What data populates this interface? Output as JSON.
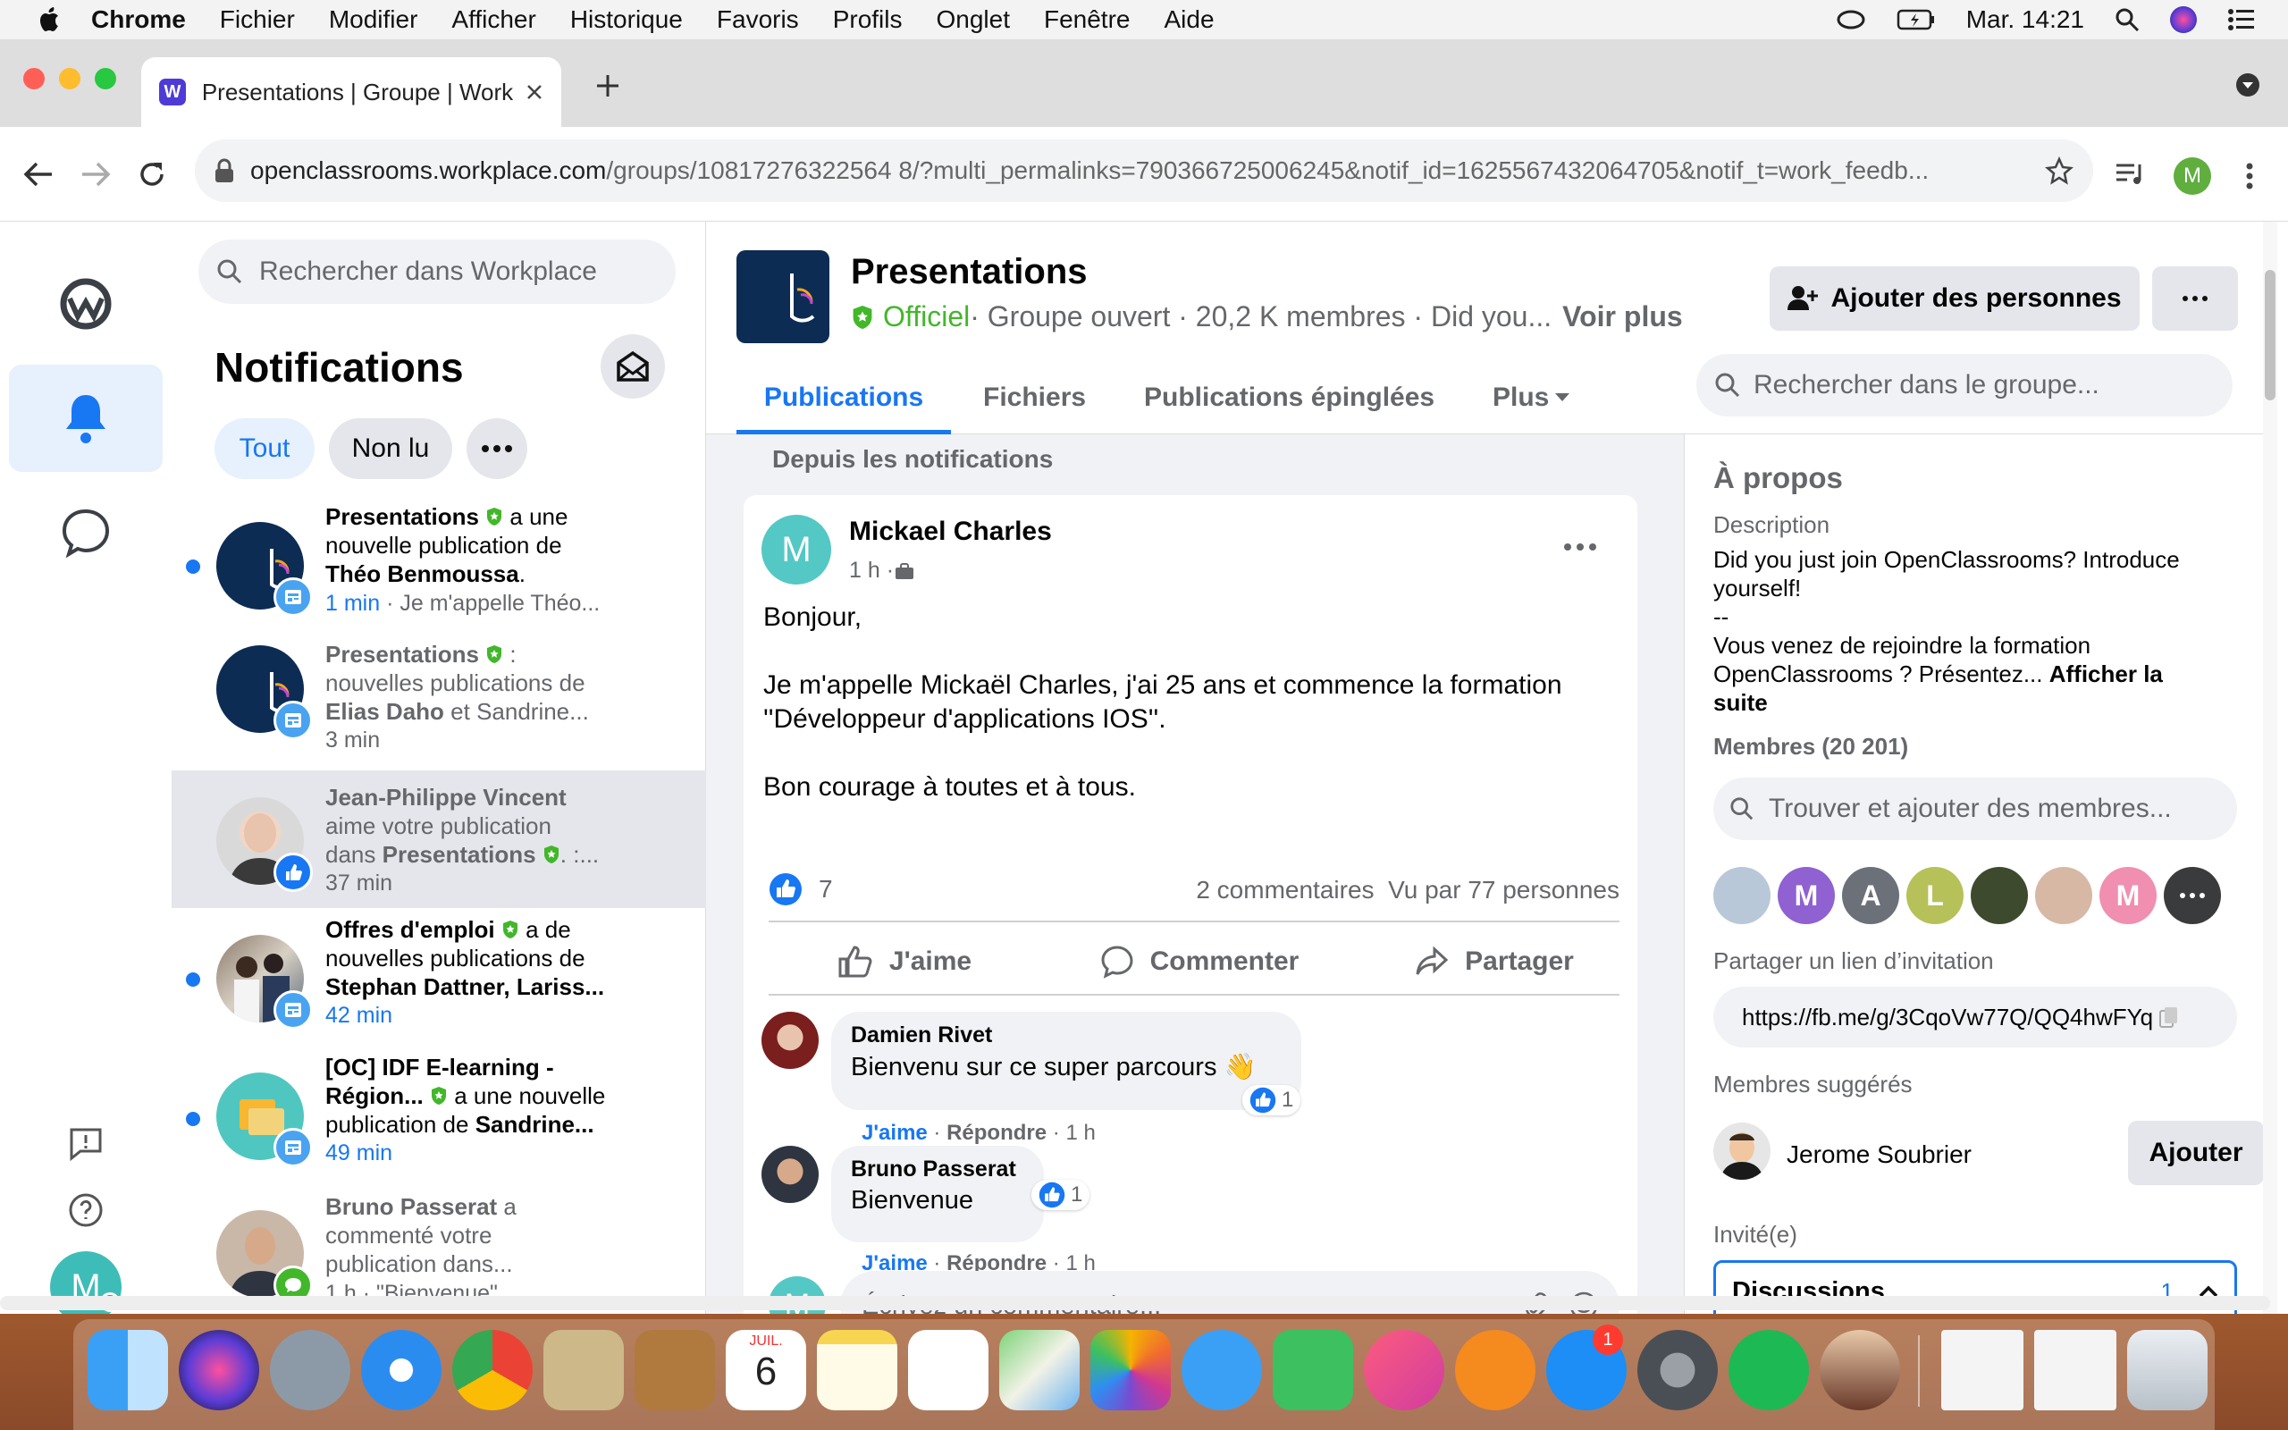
{
  "menubar": {
    "app": "Chrome",
    "items": [
      "Fichier",
      "Modifier",
      "Afficher",
      "Historique",
      "Favoris",
      "Profils",
      "Onglet",
      "Fenêtre",
      "Aide"
    ],
    "clock": "Mar. 14:21"
  },
  "browser": {
    "tab_title": "Presentations | Groupe | Workp",
    "url_host": "openclassrooms.workplace.com",
    "url_path": "/groups/10817276322564 8/?multi_permalinks=790366725006245&notif_id=1625567432064705&notif_t=work_feedb...",
    "profile_initial": "M"
  },
  "notifications": {
    "search_placeholder": "Rechercher dans Workplace",
    "title": "Notifications",
    "filter_all": "Tout",
    "filter_unread": "Non lu",
    "items": [
      {
        "line1_bold": "Presentations",
        "line1_rest": " a une",
        "line2": "nouvelle publication de",
        "line3_bold": "Théo Benmoussa",
        "line3_rest": ".",
        "time": "1 min",
        "preview": " · Je m'appelle Théo..."
      },
      {
        "line1_bold": "Presentations",
        "line1_rest": " :",
        "line2": "nouvelles publications de",
        "line3_bold": "Elias Daho",
        "line3_rest": " et Sandrine...",
        "time": "3 min",
        "preview": ""
      },
      {
        "line1_bold": "Jean-Philippe Vincent",
        "line1_rest": "",
        "line2": "aime votre publication",
        "line3_bold": "Presentations",
        "line3_pre": "dans ",
        "line3_rest": ". :...",
        "time": "37 min",
        "preview": ""
      },
      {
        "line1_bold": "Offres d'emploi",
        "line1_rest": " a de",
        "line2": "nouvelles publications de",
        "line3_bold": "Stephan Dattner, Lariss...",
        "line3_rest": "",
        "time": "42 min",
        "preview": ""
      },
      {
        "line1_bold": "[OC] IDF E-learning -",
        "line1_rest": "",
        "line2_bold": "Région...",
        "line2": " a une nouvelle",
        "line3_pre": "publication de ",
        "line3_bold": "Sandrine...",
        "line3_rest": "",
        "time": "49 min",
        "preview": ""
      },
      {
        "line1_bold": "Bruno Passerat",
        "line1_rest": " a",
        "line2": "commenté votre",
        "line3_pre": "publication dans...",
        "line3_bold": "",
        "line3_rest": "",
        "time": "1 h",
        "preview": " · \"Bienvenue\""
      }
    ]
  },
  "group": {
    "name": "Presentations",
    "official": "Officiel",
    "meta": " · Groupe ouvert · 20,2 K membres · Did you...",
    "see_more": "Voir plus",
    "add_people": "Ajouter des personnes",
    "tabs": [
      "Publications",
      "Fichiers",
      "Publications épinglées",
      "Plus"
    ],
    "search_placeholder": "Rechercher dans le groupe..."
  },
  "feed": {
    "section_label": "Depuis les notifications",
    "post": {
      "author": "Mickael Charles",
      "author_initial": "M",
      "time": "1 h · ",
      "line1": "Bonjour,",
      "line2": "Je m'appelle Mickaël Charles, j'ai 25 ans et commence la formation",
      "line3": "''Développeur d'applications IOS''.",
      "line4": "Bon courage à toutes et à tous.",
      "likes": "7",
      "comments_count": "2 commentaires",
      "seen_by": "Vu par 77 personnes",
      "like": "J'aime",
      "comment": "Commenter",
      "share": "Partager"
    },
    "comments": [
      {
        "name": "Damien Rivet",
        "text": "Bienvenu sur ce super parcours 👋",
        "reactions": "1",
        "like": "J'aime",
        "reply": "Répondre",
        "time": "1 h"
      },
      {
        "name": "Bruno Passerat",
        "text": "Bienvenue",
        "reactions": "1",
        "like": "J'aime",
        "reply": "Répondre",
        "time": "1 h"
      }
    ],
    "comment_placeholder": "Écrivez un commentaire...",
    "composer_initial": "M"
  },
  "about": {
    "title": "À propos",
    "desc_label": "Description",
    "desc_1": "Did you just join OpenClassrooms? Introduce",
    "desc_2": "yourself!",
    "desc_3": "--",
    "desc_4": "Vous venez de rejoindre la formation",
    "desc_5": "OpenClassrooms ? Présentez...",
    "show_more": "Afficher la",
    "show_more_2": "suite",
    "members_label": "Membres (20 201)",
    "members_search": "Trouver et ajouter des membres...",
    "member_initials": [
      "M",
      "A",
      "L",
      "M"
    ],
    "invite_label": "Partager un lien d’invitation",
    "invite_link": "https://fb.me/g/3CqoVw77Q/QQ4hwFYq",
    "suggested_label": "Membres suggérés",
    "suggested_name": "Jerome Soubrier",
    "suggested_button": "Ajouter",
    "invited_label": "Invité(e)",
    "chat_label": "Discussions",
    "chat_count": "1"
  },
  "dock": {
    "calendar_month": "JUIL.",
    "calendar_day": "6",
    "appstore_badge": "1"
  },
  "colors": {
    "accent": "#1877f2",
    "official": "#42b72a",
    "group_logo": "#0d2c54"
  }
}
